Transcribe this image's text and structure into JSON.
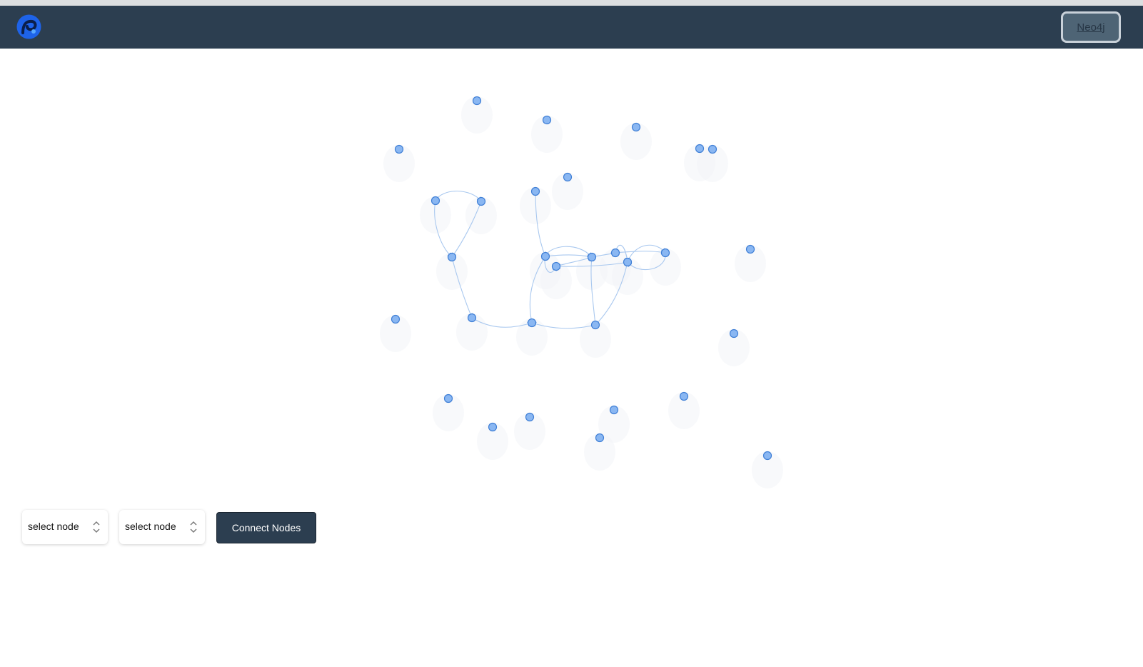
{
  "navbar": {
    "logo_icon": "app-logo-icon",
    "button_label": "Neo4j"
  },
  "controls": {
    "source_select": "select node",
    "target_select": "select node",
    "connect_label": "Connect Nodes"
  },
  "graph": {
    "node_count": 30,
    "colors": {
      "node_fill": "#8ab7f2",
      "node_stroke": "#3f7fd6",
      "edge": "#a9c8ef"
    }
  },
  "colors": {
    "navbar_bg": "#2c3e50",
    "accent_blue": "#1e63e9"
  }
}
